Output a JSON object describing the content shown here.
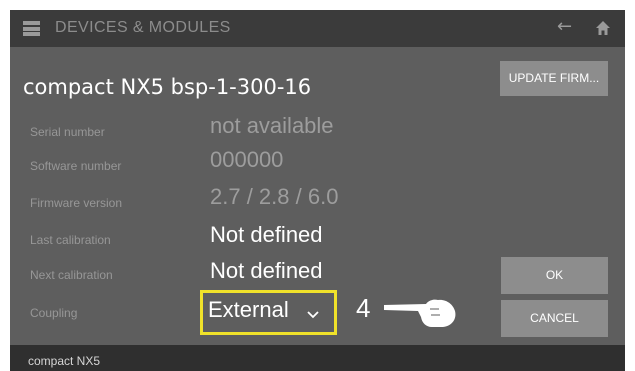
{
  "header": {
    "title": "DEVICES & MODULES",
    "menu_icon": "menu-icon",
    "back_icon": "arrow-left-icon",
    "home_icon": "home-icon"
  },
  "device": {
    "name": "compact NX5 bsp-1-300-16"
  },
  "buttons": {
    "update_firmware": "UPDATE FIRM...",
    "ok": "OK",
    "cancel": "CANCEL"
  },
  "rows": [
    {
      "label": "Serial number",
      "value": "not available"
    },
    {
      "label": "Software number",
      "value": "000000"
    },
    {
      "label": "Firmware version",
      "value": "2.7 / 2.8 / 6.0"
    },
    {
      "label": "Last calibration",
      "value": "Not defined"
    },
    {
      "label": "Next calibration",
      "value": "Not defined"
    },
    {
      "label": "Coupling",
      "value": "External"
    }
  ],
  "annotation": {
    "step_number": "4",
    "pointer_icon": "pointing-hand-icon",
    "highlight_color": "#f0e22a"
  },
  "status_bar": {
    "text": "compact NX5"
  },
  "colors": {
    "topbar": "#3b3b3b",
    "panel": "#5e5e5e",
    "button": "#8d8d8d",
    "statusbar": "#2f2f2f"
  }
}
